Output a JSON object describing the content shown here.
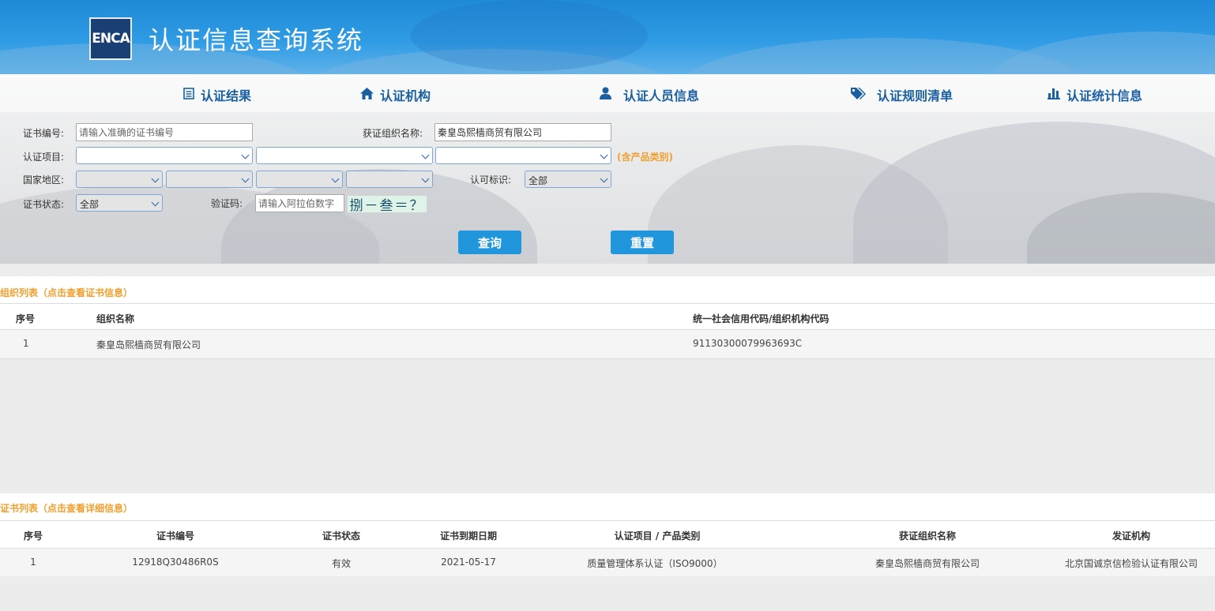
{
  "header": {
    "logo_text": "ENCA",
    "title": "认证信息查询系统"
  },
  "nav": [
    {
      "label": "认证结果",
      "icon": "list-icon"
    },
    {
      "label": "认证机构",
      "icon": "home-icon"
    },
    {
      "label": "认证人员信息",
      "icon": "user-icon"
    },
    {
      "label": "认证规则清单",
      "icon": "tags-icon"
    },
    {
      "label": "认证统计信息",
      "icon": "bar-chart-icon"
    }
  ],
  "form": {
    "cert_no_label": "证书编号:",
    "cert_no_placeholder": "请输入准确的证书编号",
    "org_name_label": "获证组织名称:",
    "org_name_value": "秦皇岛熙樯商贸有限公司",
    "project_label": "认证项目:",
    "project_hint": "(含产品类别)",
    "region_label": "国家地区:",
    "accred_label": "认可标识:",
    "accred_value": "全部",
    "status_label": "证书状态:",
    "status_value": "全部",
    "captcha_label": "验证码:",
    "captcha_placeholder": "请输入阿拉伯数字",
    "captcha_text": "捌－叁＝？",
    "query_button": "查询",
    "reset_button": "重置"
  },
  "org_list": {
    "title": "组织列表（点击查看证书信息）",
    "headers": [
      "序号",
      "组织名称",
      "统一社会信用代码/组织机构代码"
    ],
    "rows": [
      [
        "1",
        "秦皇岛熙樯商贸有限公司",
        "91130300079963693C"
      ]
    ]
  },
  "cert_list": {
    "title": "证书列表（点击查看详细信息）",
    "headers": [
      "序号",
      "证书编号",
      "证书状态",
      "证书到期日期",
      "认证项目 / 产品类别",
      "获证组织名称",
      "发证机构"
    ],
    "rows": [
      [
        "1",
        "12918Q30486R0S",
        "有效",
        "2021-05-17",
        "质量管理体系认证（ISO9000）",
        "秦皇岛熙樯商贸有限公司",
        "北京国诚京信检验认证有限公司"
      ]
    ]
  }
}
